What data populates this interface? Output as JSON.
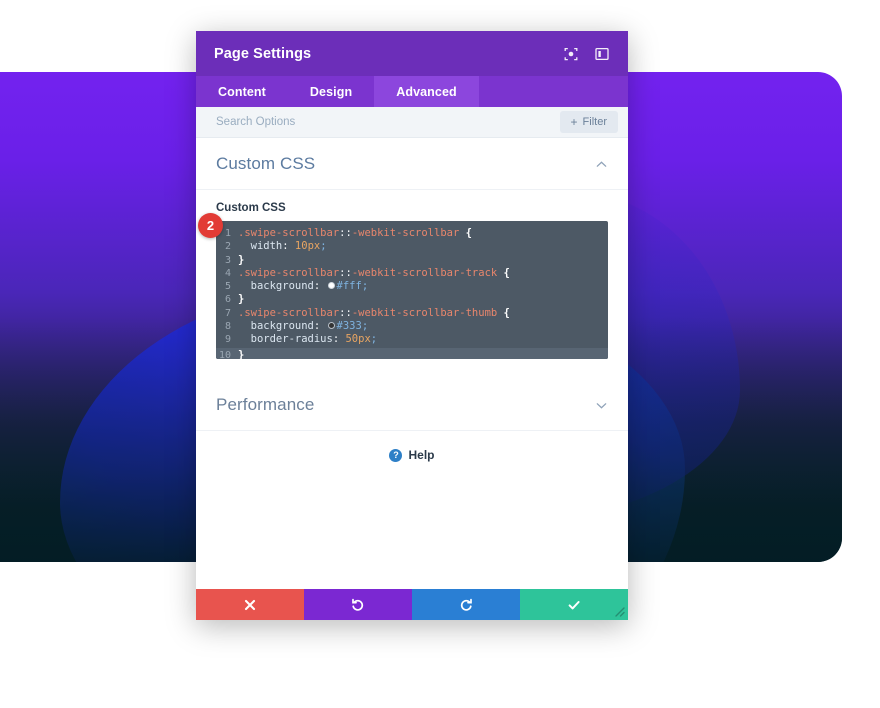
{
  "window": {
    "title": "Page Settings",
    "header_icons": [
      {
        "name": "focus-target-icon",
        "label": "Focus"
      },
      {
        "name": "layout-panel-icon",
        "label": "Layout"
      }
    ]
  },
  "tabs": [
    {
      "id": "content",
      "label": "Content",
      "active": false
    },
    {
      "id": "design",
      "label": "Design",
      "active": false
    },
    {
      "id": "advanced",
      "label": "Advanced",
      "active": true
    }
  ],
  "search": {
    "value": "",
    "placeholder": "Search Options",
    "filter_label": "Filter",
    "filter_plus": "+"
  },
  "sections": [
    {
      "id": "custom-css",
      "title": "Custom CSS",
      "expanded": true,
      "chevron": "up"
    },
    {
      "id": "performance",
      "title": "Performance",
      "expanded": false,
      "chevron": "down"
    }
  ],
  "custom_css_field": {
    "label": "Custom CSS",
    "marker_badge": "2",
    "lines": [
      {
        "n": "1",
        "tokens": [
          {
            "t": ".swipe-scrollbar",
            "c": "c-sel"
          },
          {
            "t": "::",
            "c": "c-pun"
          },
          {
            "t": "-webkit-scrollbar",
            "c": "c-sel"
          },
          {
            "t": " ",
            "c": "c-pun"
          },
          {
            "t": "{",
            "c": "c-brace"
          }
        ]
      },
      {
        "n": "2",
        "tokens": [
          {
            "t": "  width",
            "c": "c-prop"
          },
          {
            "t": ": ",
            "c": "c-pun"
          },
          {
            "t": "10px",
            "c": "c-num"
          },
          {
            "t": ";",
            "c": "c-semi"
          }
        ]
      },
      {
        "n": "3",
        "tokens": [
          {
            "t": "}",
            "c": "c-brace"
          }
        ]
      },
      {
        "n": "4",
        "tokens": [
          {
            "t": ".swipe-scrollbar",
            "c": "c-sel"
          },
          {
            "t": "::",
            "c": "c-pun"
          },
          {
            "t": "-webkit-scrollbar-track",
            "c": "c-sel"
          },
          {
            "t": " ",
            "c": "c-pun"
          },
          {
            "t": "{",
            "c": "c-brace"
          }
        ]
      },
      {
        "n": "5",
        "tokens": [
          {
            "t": "  background",
            "c": "c-prop"
          },
          {
            "t": ": ",
            "c": "c-pun"
          },
          {
            "t": "",
            "c": "sw-white",
            "swatch": true
          },
          {
            "t": "#fff",
            "c": "c-hex"
          },
          {
            "t": ";",
            "c": "c-semi"
          }
        ]
      },
      {
        "n": "6",
        "tokens": [
          {
            "t": "}",
            "c": "c-brace"
          }
        ]
      },
      {
        "n": "7",
        "tokens": [
          {
            "t": ".swipe-scrollbar",
            "c": "c-sel"
          },
          {
            "t": "::",
            "c": "c-pun"
          },
          {
            "t": "-webkit-scrollbar-thumb",
            "c": "c-sel"
          },
          {
            "t": " ",
            "c": "c-pun"
          },
          {
            "t": "{",
            "c": "c-brace"
          }
        ]
      },
      {
        "n": "8",
        "tokens": [
          {
            "t": "  background",
            "c": "c-prop"
          },
          {
            "t": ": ",
            "c": "c-pun"
          },
          {
            "t": "",
            "c": "sw-dark",
            "swatch": true
          },
          {
            "t": "#333",
            "c": "c-hex"
          },
          {
            "t": ";",
            "c": "c-semi"
          }
        ]
      },
      {
        "n": "9",
        "tokens": [
          {
            "t": "  border-radius",
            "c": "c-prop"
          },
          {
            "t": ": ",
            "c": "c-pun"
          },
          {
            "t": "50px",
            "c": "c-num"
          },
          {
            "t": ";",
            "c": "c-semi"
          }
        ]
      },
      {
        "n": "10",
        "tokens": [
          {
            "t": "}",
            "c": "c-brace"
          }
        ],
        "highlight": true
      }
    ],
    "raw_text": ".swipe-scrollbar::-webkit-scrollbar {\n  width: 10px;\n}\n.swipe-scrollbar::-webkit-scrollbar-track {\n  background: #fff;\n}\n.swipe-scrollbar::-webkit-scrollbar-thumb {\n  background: #333;\n  border-radius: 50px;\n}"
  },
  "help": {
    "label": "Help",
    "icon_glyph": "?"
  },
  "actions": [
    {
      "id": "cancel",
      "name": "cancel-button",
      "icon": "close-x-icon",
      "color": "#e8544e"
    },
    {
      "id": "undo",
      "name": "undo-button",
      "icon": "undo-arrow-icon",
      "color": "#7b28d2"
    },
    {
      "id": "redo",
      "name": "redo-button",
      "icon": "redo-arrow-icon",
      "color": "#2a7fd4"
    },
    {
      "id": "save",
      "name": "save-button",
      "icon": "checkmark-icon",
      "color": "#2ec49a"
    }
  ],
  "colors": {
    "header_purple": "#6c2eb9",
    "tabbar_purple": "#7b34cf",
    "tab_active_purple": "#8c46dd",
    "badge_red": "#e23b35",
    "editor_bg": "#4d5965",
    "hero_top": "#7322ef",
    "hero_bottom": "#05222a",
    "blob_blue": "#2a2ae0"
  }
}
